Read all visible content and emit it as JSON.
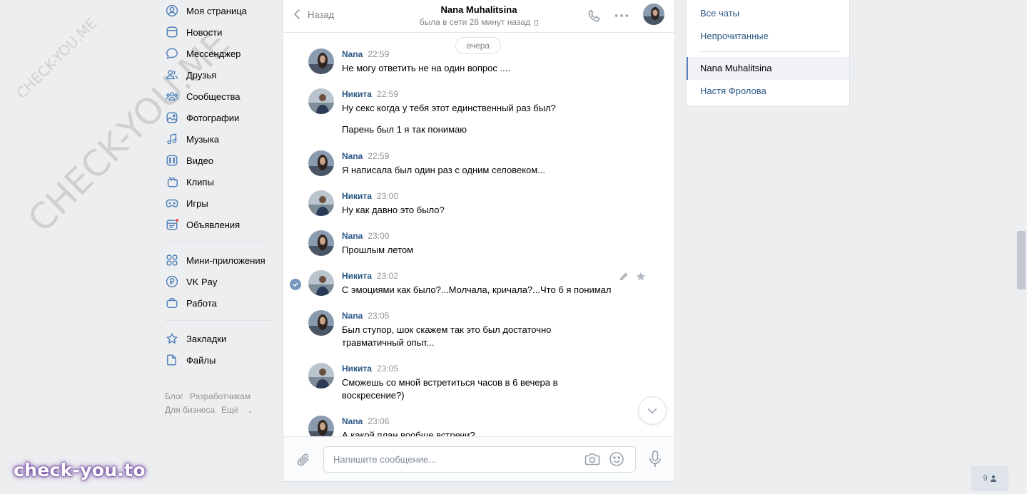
{
  "left_nav": {
    "items": [
      {
        "label": "Моя страница",
        "icon": "user-circle-icon"
      },
      {
        "label": "Новости",
        "icon": "news-icon"
      },
      {
        "label": "Мессенджер",
        "icon": "message-icon"
      },
      {
        "label": "Друзья",
        "icon": "friends-icon"
      },
      {
        "label": "Сообщества",
        "icon": "communities-icon"
      },
      {
        "label": "Фотографии",
        "icon": "photo-icon"
      },
      {
        "label": "Музыка",
        "icon": "music-icon"
      },
      {
        "label": "Видео",
        "icon": "video-icon"
      },
      {
        "label": "Клипы",
        "icon": "clips-icon"
      },
      {
        "label": "Игры",
        "icon": "games-icon"
      },
      {
        "label": "Объявления",
        "icon": "ads-icon"
      }
    ],
    "items2": [
      {
        "label": "Мини-приложения",
        "icon": "apps-icon"
      },
      {
        "label": "VK Pay",
        "icon": "vkpay-icon"
      },
      {
        "label": "Работа",
        "icon": "briefcase-icon"
      }
    ],
    "items3": [
      {
        "label": "Закладки",
        "icon": "star-icon"
      },
      {
        "label": "Файлы",
        "icon": "file-icon"
      }
    ],
    "footer": {
      "blog": "Блог",
      "dev": "Разработчикам",
      "business": "Для бизнеса",
      "more": "Ещё"
    }
  },
  "chat": {
    "back_label": "Назад",
    "peer_name": "Nana Muhalitsina",
    "peer_status": "была в сети 28 минут назад",
    "date_divider": "вчера",
    "messages": [
      {
        "author": "Nana",
        "time": "22:59",
        "text": "Не могу ответить не на один вопрос ...."
      },
      {
        "author": "Никита",
        "time": "22:59",
        "text": "Ну секс когда у тебя этот единственный раз был?",
        "text2": "Парень был 1 я так понимаю"
      },
      {
        "author": "Nana",
        "time": "22:59",
        "text": "Я написала был один раз с одним селовеком..."
      },
      {
        "author": "Никита",
        "time": "23:00",
        "text": "Ну как давно это было?"
      },
      {
        "author": "Nana",
        "time": "23:00",
        "text": "Прошлым летом"
      },
      {
        "author": "Никита",
        "time": "23:02",
        "text": "С эмоциями как было?...Молчала, кричала?...Что б я понимал"
      },
      {
        "author": "Nana",
        "time": "23:05",
        "text": "Был ступор, шок скажем так это был достаточно травматичный опыт..."
      },
      {
        "author": "Никита",
        "time": "23:05",
        "text": "Сможешь со мной встретиться часов в 6 вечера в воскресение?)"
      },
      {
        "author": "Nana",
        "time": "23:06",
        "text": "А какой план вообще встречи?"
      }
    ],
    "input_placeholder": "Напишите сообщение..."
  },
  "right_panel": {
    "all_chats": "Все чаты",
    "unread": "Непрочитанные",
    "chat1": "Nana Muhalitsina",
    "chat2": "Настя Фролова"
  },
  "watermarks": {
    "small": "CHECK-YOU.ME",
    "large": "CHECK-YOU.ME",
    "brand": "check-you.to"
  },
  "friends_badge": "9",
  "colors": {
    "link": "#2a5885",
    "accent": "#5181b8",
    "bg": "#edeef0"
  }
}
